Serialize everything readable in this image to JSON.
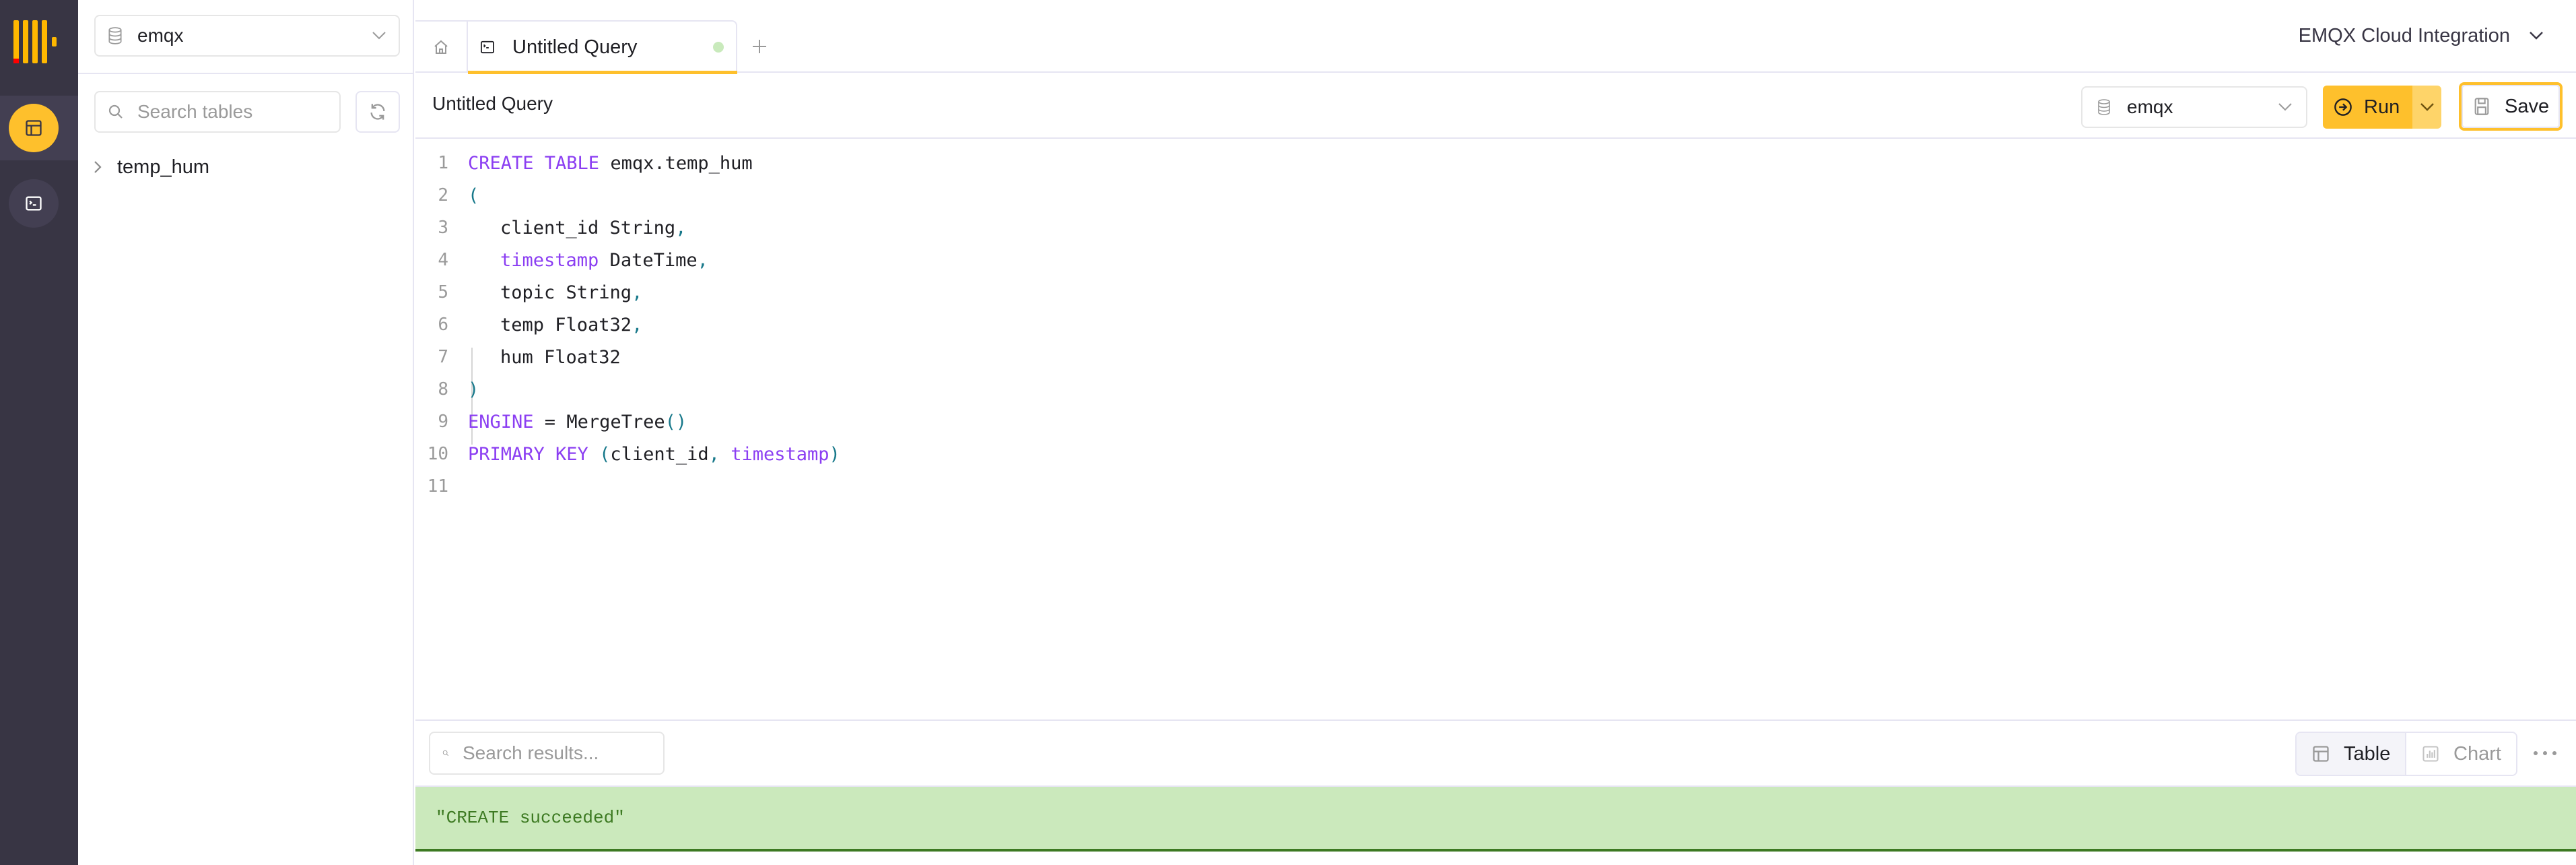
{
  "rail": {
    "logo": "clickhouse-logo",
    "items": [
      {
        "name": "tables",
        "icon": "table-layout-icon",
        "active": true
      },
      {
        "name": "queries",
        "icon": "terminal-icon",
        "active": false
      }
    ]
  },
  "sidebar": {
    "database_select": {
      "value": "emqx",
      "icon": "database-icon"
    },
    "search": {
      "placeholder": "Search tables",
      "value": ""
    },
    "refresh_icon": "refresh-icon",
    "tables": [
      {
        "name": "temp_hum",
        "expanded": false
      }
    ]
  },
  "topbar": {
    "home_icon": "home-icon",
    "tabs": [
      {
        "label": "Untitled Query",
        "icon": "terminal-icon",
        "active": true,
        "status_color": "#c9eabc"
      }
    ],
    "new_tab_icon": "plus-icon",
    "org": {
      "label": "EMQX Cloud Integration"
    }
  },
  "toolbar": {
    "title": "Untitled Query",
    "database_select": {
      "value": "emqx"
    },
    "run_label": "Run",
    "save_label": "Save"
  },
  "editor": {
    "lines": [
      {
        "no": "1",
        "tokens": [
          {
            "t": "CREATE TABLE",
            "c": "kw"
          },
          {
            "t": " emqx.temp_hum",
            "c": ""
          }
        ]
      },
      {
        "no": "2",
        "tokens": [
          {
            "t": "(",
            "c": "pn"
          }
        ]
      },
      {
        "no": "3",
        "indent": true,
        "tokens": [
          {
            "t": "client_id String",
            "c": ""
          },
          {
            "t": ",",
            "c": "pn"
          }
        ]
      },
      {
        "no": "4",
        "indent": true,
        "tokens": [
          {
            "t": "timestamp",
            "c": "kw"
          },
          {
            "t": " DateTime",
            "c": ""
          },
          {
            "t": ",",
            "c": "pn"
          }
        ]
      },
      {
        "no": "5",
        "indent": true,
        "tokens": [
          {
            "t": "topic String",
            "c": ""
          },
          {
            "t": ",",
            "c": "pn"
          }
        ]
      },
      {
        "no": "6",
        "indent": true,
        "tokens": [
          {
            "t": "temp Float32",
            "c": ""
          },
          {
            "t": ",",
            "c": "pn"
          }
        ]
      },
      {
        "no": "7",
        "indent": true,
        "tokens": [
          {
            "t": "hum Float32",
            "c": ""
          }
        ]
      },
      {
        "no": "8",
        "tokens": [
          {
            "t": ")",
            "c": "pn"
          }
        ]
      },
      {
        "no": "9",
        "tokens": [
          {
            "t": "ENGINE",
            "c": "kw"
          },
          {
            "t": " = MergeTree",
            "c": ""
          },
          {
            "t": "()",
            "c": "pn"
          }
        ]
      },
      {
        "no": "10",
        "tokens": [
          {
            "t": "PRIMARY KEY",
            "c": "kw"
          },
          {
            "t": " ",
            "c": ""
          },
          {
            "t": "(",
            "c": "pn"
          },
          {
            "t": "client_id",
            "c": ""
          },
          {
            "t": ",",
            "c": "pn"
          },
          {
            "t": " ",
            "c": ""
          },
          {
            "t": "timestamp",
            "c": "kw"
          },
          {
            "t": ")",
            "c": "pn"
          }
        ]
      },
      {
        "no": "11",
        "tokens": []
      }
    ]
  },
  "results": {
    "search": {
      "placeholder": "Search results...",
      "value": ""
    },
    "view_options": [
      {
        "label": "Table",
        "icon": "table-icon",
        "selected": true
      },
      {
        "label": "Chart",
        "icon": "chart-icon",
        "selected": false
      }
    ],
    "more_icon": "more-horizontal-icon",
    "message": "\"CREATE succeeded\"",
    "message_bg": "#cbe9bc",
    "message_color": "#3d7a22"
  },
  "colors": {
    "accent": "#fec02c",
    "rail_bg": "#383544",
    "keyword": "#8b3ef2",
    "punctuation": "#17788a"
  }
}
